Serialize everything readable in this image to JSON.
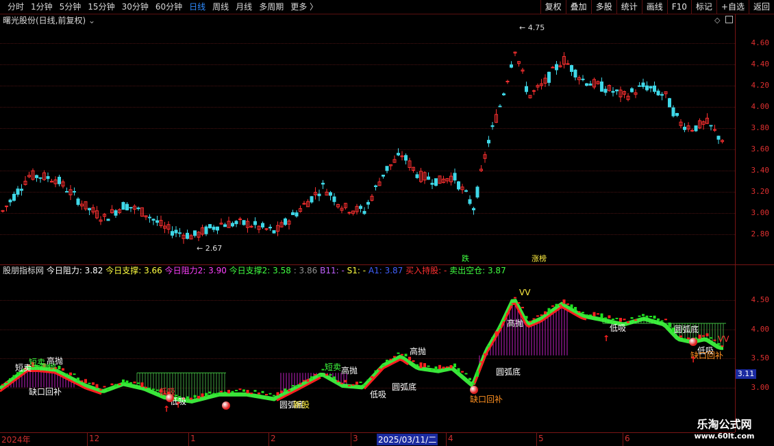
{
  "toolbar": {
    "periods": [
      "分时",
      "1分钟",
      "5分钟",
      "15分钟",
      "30分钟",
      "60分钟",
      "日线",
      "周线",
      "月线",
      "多周期",
      "更多 〉"
    ],
    "active_period": "日线",
    "actions": [
      "复权",
      "叠加",
      "多股",
      "统计",
      "画线",
      "F10",
      "标记",
      "+自选",
      "返回"
    ]
  },
  "main_panel": {
    "title": "曙光股份(日线,前复权)",
    "y_ticks": [
      "4.60",
      "4.40",
      "4.20",
      "4.00",
      "3.80",
      "3.60",
      "3.40",
      "3.20",
      "3.00",
      "2.80"
    ],
    "high_label": "4.75",
    "low_label": "2.67",
    "markers": [
      "跌",
      "涨榜"
    ]
  },
  "indicator": {
    "name": "股朋指标网",
    "fields": [
      {
        "label": "今日阻力:",
        "value": "3.82",
        "color": "#ffffff"
      },
      {
        "label": "今日支撑:",
        "value": "3.66",
        "color": "#ffff40"
      },
      {
        "label": "今日阻力2:",
        "value": "3.90",
        "color": "#ff40ff"
      },
      {
        "label": "今日支撑2:",
        "value": "3.58",
        "color": "#40ff40"
      },
      {
        "label": ":",
        "value": "3.86",
        "color": "#909090"
      },
      {
        "label": "B11:",
        "value": "-",
        "color": "#c060ff"
      },
      {
        "label": "S1:",
        "value": "-",
        "color": "#ffff40"
      },
      {
        "label": "A1:",
        "value": "3.87",
        "color": "#4060ff"
      },
      {
        "label": "买入持股:",
        "value": "-",
        "color": "#ff3030"
      },
      {
        "label": "卖出空仓:",
        "value": "3.87",
        "color": "#40ff40"
      }
    ],
    "y_ticks": [
      "4.50",
      "4.00",
      "3.50",
      "3.00"
    ],
    "current_price": "3.11",
    "annotations": [
      "短卖",
      "高抛",
      "短卖",
      "高抛",
      "缺口回补",
      "低吸",
      "低吸",
      "圆弧底",
      "新股",
      "短卖",
      "高抛",
      "低吸",
      "圆弧底",
      "高抛",
      "圆弧底",
      "缺口回补",
      "高抛",
      "VV",
      "低吸",
      "圆弧底",
      "低吸",
      "缺口回补",
      "VV"
    ]
  },
  "xaxis": {
    "labels": [
      "2024年",
      "12",
      "1",
      "2",
      "3",
      "2025/03/11/二",
      "4",
      "5",
      "6"
    ]
  },
  "watermark": {
    "site": "乐淘公式网",
    "url": "www.60lt.com"
  },
  "colors": {
    "up": "#ff3030",
    "down": "#3fd8e8",
    "ma": "#ff2020",
    "band": "#40ff40"
  }
}
